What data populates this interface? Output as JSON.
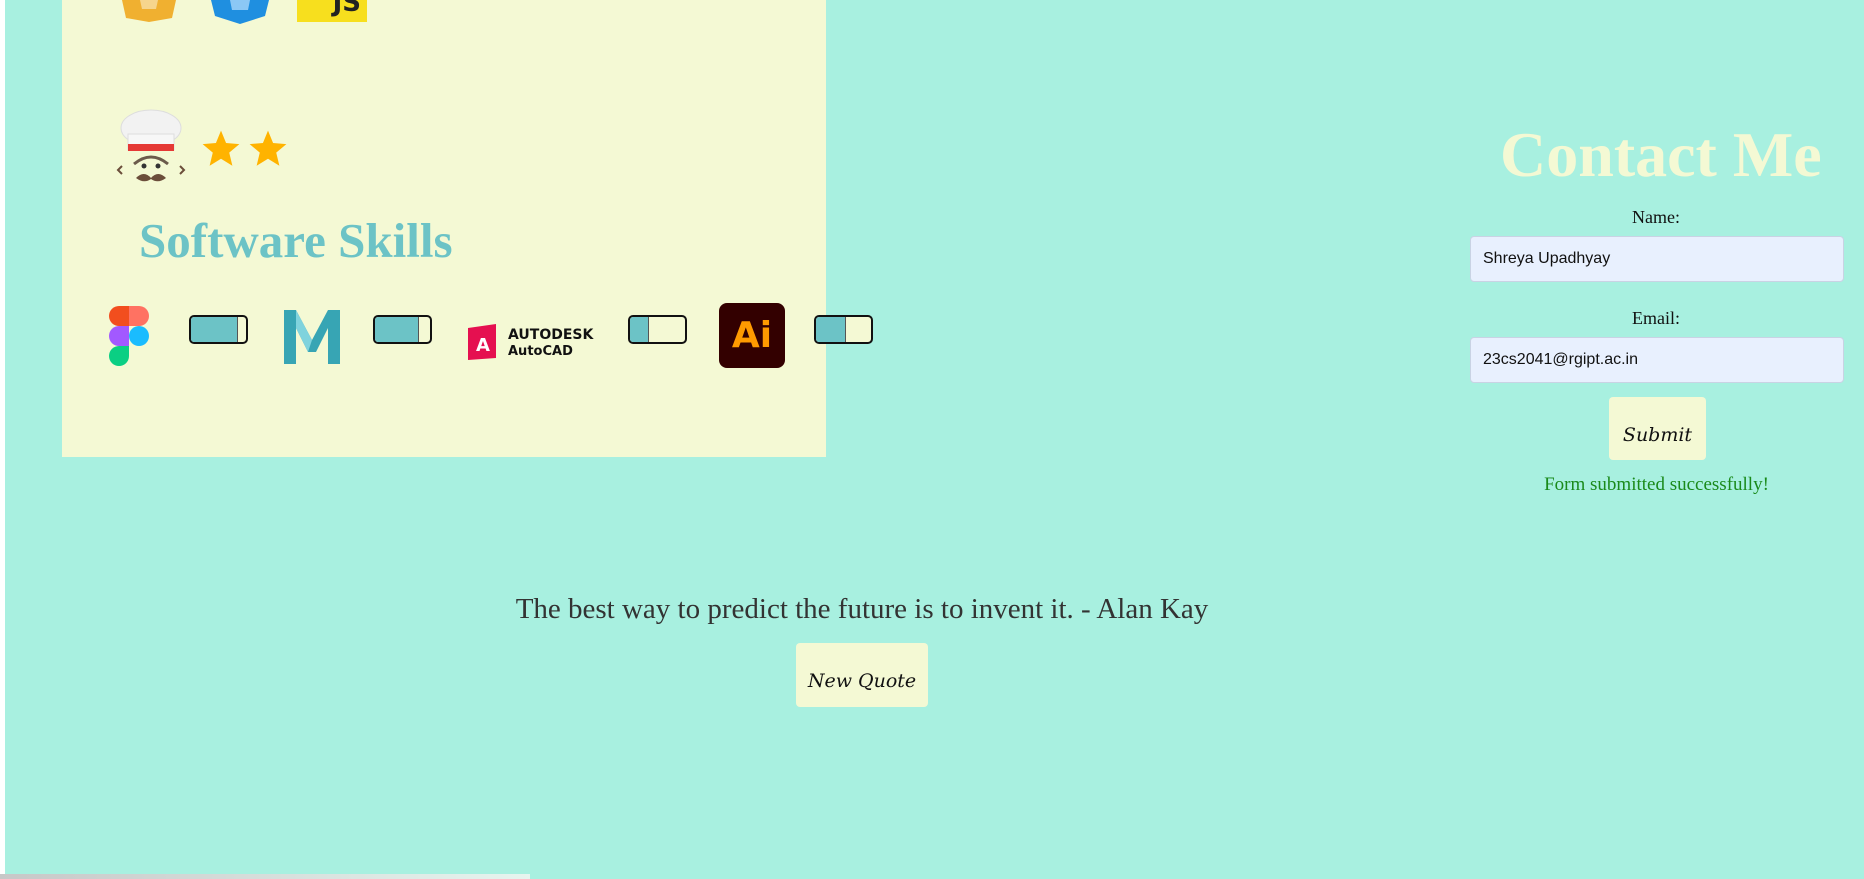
{
  "skills_panel": {
    "top_logos": [
      "html5-logo",
      "css3-logo",
      "javascript-logo"
    ],
    "js_logo_text": "JS",
    "chef_icon": "chef-icon",
    "star_rating": 2,
    "heading": "Software Skills",
    "software": [
      {
        "logo": "figma-logo",
        "level": 0.85
      },
      {
        "logo": "maya-logo",
        "level": 0.8
      },
      {
        "logo": "autocad-logo",
        "label_line1": "AUTODESK",
        "label_line2": "AutoCAD",
        "level": 0.35
      },
      {
        "logo": "adobe-illustrator-logo",
        "label": "Ai",
        "level": 0.55
      }
    ]
  },
  "contact": {
    "title": "Contact Me",
    "name_label": "Name:",
    "name_value": "Shreya Upadhyay",
    "email_label": "Email:",
    "email_value": "23cs2041@rgipt.ac.in",
    "submit_label": "Submit",
    "success_message": "Form submitted successfully!"
  },
  "quote": {
    "text": "The best way to predict the future is to invent it. - Alan Kay",
    "new_quote_label": "New Quote"
  },
  "colors": {
    "background": "#a8f0e0",
    "panel": "#f4f9d4",
    "accent": "#6cc3c6",
    "success": "#1a8a1a"
  }
}
